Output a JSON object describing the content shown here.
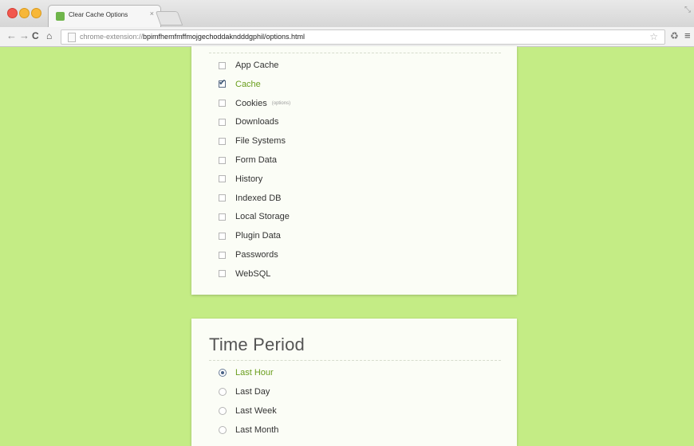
{
  "browser": {
    "tab_title": "Clear Cache Options",
    "tab_close": "×",
    "url_scheme": "chrome-extension://",
    "url_rest": "bpimfhemfmffmojgechoddakndddgphil/options.html"
  },
  "data_types": [
    {
      "label": "App Cache",
      "checked": false
    },
    {
      "label": "Cache",
      "checked": true
    },
    {
      "label": "Cookies",
      "note": "(options)",
      "checked": false
    },
    {
      "label": "Downloads",
      "checked": false
    },
    {
      "label": "File Systems",
      "checked": false
    },
    {
      "label": "Form Data",
      "checked": false
    },
    {
      "label": "History",
      "checked": false
    },
    {
      "label": "Indexed DB",
      "checked": false
    },
    {
      "label": "Local Storage",
      "checked": false
    },
    {
      "label": "Plugin Data",
      "checked": false
    },
    {
      "label": "Passwords",
      "checked": false
    },
    {
      "label": "WebSQL",
      "checked": false
    }
  ],
  "time_period": {
    "title": "Time Period",
    "options": [
      {
        "label": "Last Hour",
        "selected": true
      },
      {
        "label": "Last Day",
        "selected": false
      },
      {
        "label": "Last Week",
        "selected": false
      },
      {
        "label": "Last Month",
        "selected": false
      }
    ]
  },
  "colors": {
    "page_background": "#c4ec85",
    "active_label": "#6a9e1d"
  }
}
